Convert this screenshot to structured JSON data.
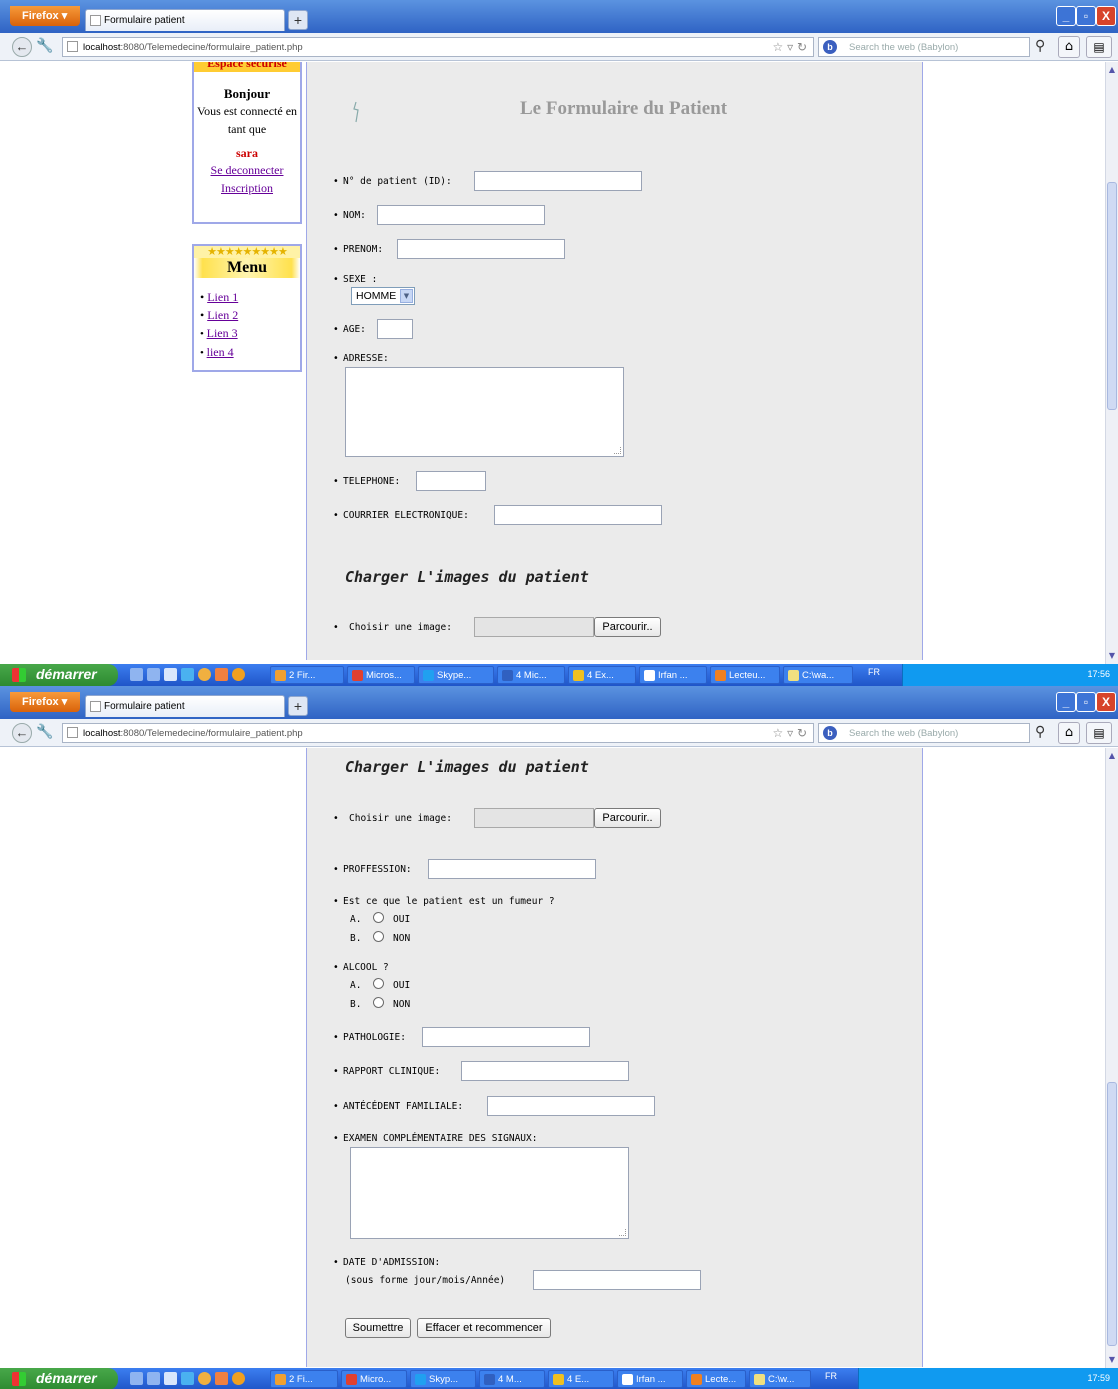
{
  "browser": {
    "menu_button": "Firefox ▾",
    "tab_title": "Formulaire patient",
    "new_tab": "+",
    "url_host": "localhost",
    "url_rest": ":8080/Telemedecine/formulaire_patient.php",
    "search_placeholder": "Search the web (Babylon)",
    "window_min": "_",
    "window_max": "▫",
    "window_close": "X"
  },
  "taskbar": {
    "start_label": "démarrer",
    "lang": "FR",
    "shot1_items": [
      "2 Fir...",
      "Micros...",
      "Skype...",
      "4 Mic...",
      "4 Ex...",
      "Irfan ...",
      "Lecteu...",
      "C:\\wa..."
    ],
    "shot2_items": [
      "2 Fi...",
      "Micro...",
      "Skyp...",
      "4 M...",
      "4 E...",
      "Irfan ...",
      "Lecte...",
      "C:\\w..."
    ],
    "time1": "17:56",
    "time2": "17:59"
  },
  "sidebar": {
    "banner": "Espace sécurisé",
    "greeting": "Bonjour",
    "connected_line1": "Vous est connecté en",
    "connected_line2": "tant que",
    "username": "sara",
    "logout": "Se deconnecter",
    "register": "Inscription",
    "stars": "★★★★★★★★★",
    "menu_title": "Menu",
    "menu_links": [
      "Lien 1",
      "Lien 2",
      "Lien 3",
      "lien 4"
    ]
  },
  "form": {
    "title": "Le Formulaire du Patient",
    "bullet": "•",
    "labels": {
      "patient_id": "N° de patient (ID):",
      "nom": "NOM:",
      "prenom": "PRENOM:",
      "sexe": "SEXE   :",
      "age": "AGE:",
      "adresse": "ADRESSE:",
      "telephone": "TELEPHONE:",
      "email": "COURRIER ELECTRONIQUE:",
      "load_images": "Charger L'images du patient",
      "choose_image": "Choisir une image:",
      "profession": "PROFFESSION:",
      "smoker": "Est ce que le patient est un fumeur ?",
      "alcool": "ALCOOL ?",
      "pathologie": "PATHOLOGIE:",
      "rapport": "RAPPORT CLINIQUE:",
      "antecedent": "ANTÉCÉDENT FAMILIALE:",
      "examen": "EXAMEN COMPLÉMENTAIRE DES SIGNAUX:",
      "date_admission": "DATE D'ADMISSION:",
      "date_hint": "(sous forme jour/mois/Année)"
    },
    "sexe_selected": "HOMME",
    "radio_a": "A.",
    "radio_b": "B.",
    "yes": "OUI",
    "no": "NON",
    "browse_button": "Parcourir..",
    "submit_button": "Soumettre",
    "reset_button": "Effacer et recommencer"
  },
  "colors": {
    "titlebar": "#2f63c4",
    "taskbar": "#1f55c8",
    "start": "#2d8a30",
    "form_bg": "#ebebeb",
    "border_blue": "#9fa8e8",
    "link": "#660099",
    "user_red": "#cc0000"
  },
  "icons": [
    "back-arrow-icon",
    "wrench-icon",
    "star-icon",
    "reload-icon",
    "magnifier-icon",
    "home-icon",
    "bookmarks-icon",
    "windows-flag-icon",
    "tooth-logo-icon"
  ]
}
